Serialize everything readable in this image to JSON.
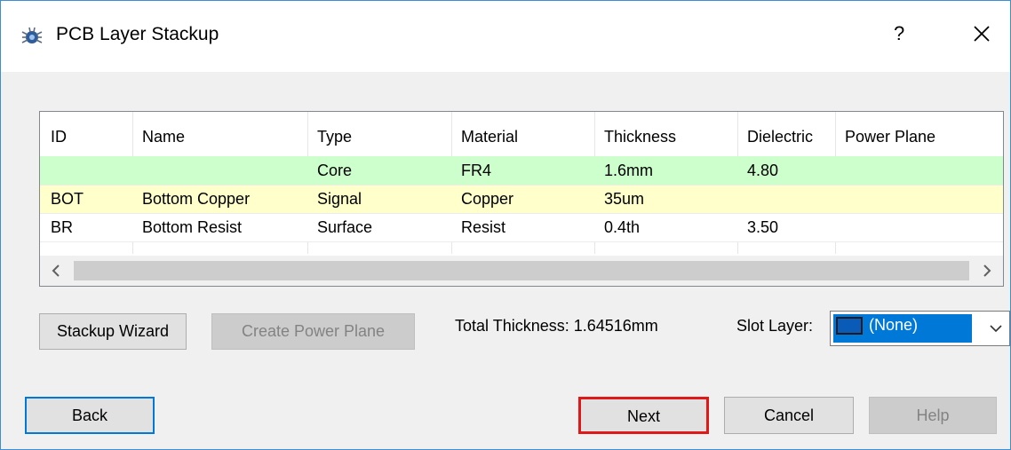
{
  "window": {
    "title": "PCB Layer Stackup",
    "help_glyph": "?",
    "app_icon": "pcb-bug-icon",
    "close_icon": "close-icon"
  },
  "table": {
    "headers": [
      "ID",
      "Name",
      "Type",
      "Material",
      "Thickness",
      "Dielectric",
      "Power Plane"
    ],
    "rows": [
      {
        "id": "",
        "name": "",
        "type": "Core",
        "material": "FR4",
        "thickness": "1.6mm",
        "dielectric": "4.80",
        "power_plane": "",
        "color": "#ccffcc"
      },
      {
        "id": "BOT",
        "name": "Bottom Copper",
        "type": "Signal",
        "material": "Copper",
        "thickness": "35um",
        "dielectric": "",
        "power_plane": "",
        "color": "#ffffcc"
      },
      {
        "id": "BR",
        "name": "Bottom Resist",
        "type": "Surface",
        "material": "Resist",
        "thickness": "0.4th",
        "dielectric": "3.50",
        "power_plane": "",
        "color": "#ffffff"
      }
    ]
  },
  "buttons": {
    "stackup_wizard": "Stackup Wizard",
    "create_power_plane": "Create Power Plane",
    "back": "Back",
    "next": "Next",
    "cancel": "Cancel",
    "help": "Help"
  },
  "total_thickness": "Total Thickness: 1.64516mm",
  "slot_layer": {
    "label": "Slot Layer:",
    "selected": "(None)",
    "swatch_color": "#0a5ab8"
  },
  "colors": {
    "accent": "#0078d7",
    "next_highlight": "#e01818"
  }
}
